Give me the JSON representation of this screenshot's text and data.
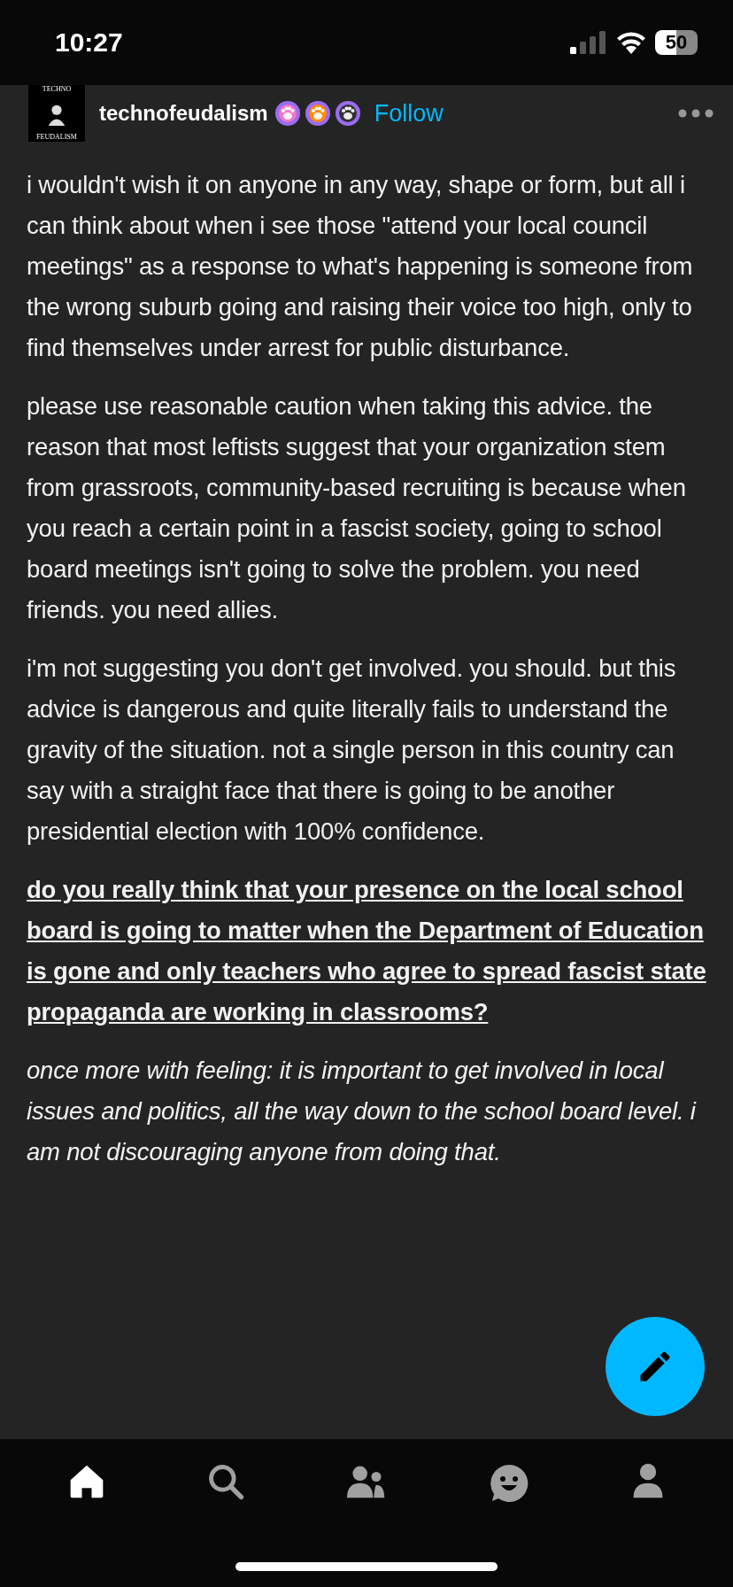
{
  "status_bar": {
    "time": "10:27",
    "battery": "50"
  },
  "post_header": {
    "avatar_top": "TECHNO",
    "avatar_bottom": "FEUDALISM",
    "username": "technofeudalism",
    "badges": [
      {
        "color": "#f277c6"
      },
      {
        "color": "#ff8a00"
      },
      {
        "color": "#333333"
      }
    ],
    "follow": "Follow"
  },
  "paragraphs": [
    {
      "kind": "plain",
      "text": "i wouldn't wish it on anyone in any way, shape or form, but all i can think about when i see those \"attend your local council meetings\" as a response to what's happening is someone from the wrong suburb going and raising their voice too high, only to find themselves under arrest for public disturbance."
    },
    {
      "kind": "plain",
      "text": "please use reasonable caution when taking this advice. the reason that most leftists suggest that your organization stem from grassroots, community-based recruiting is because when you reach a certain point in a fascist society, going to school board meetings isn't going to solve the problem. you need friends. you need allies."
    },
    {
      "kind": "plain",
      "text": "i'm not suggesting you don't get involved. you should. but this advice is dangerous and quite literally fails to understand the gravity of the situation. not a single person in this country can say with a straight face that there is going to be another presidential election with 100% confidence."
    },
    {
      "kind": "bold-underline",
      "text": "do you really think that your presence on the local school board is going to matter when the Department of Education is gone and only teachers who agree to spread fascist state propaganda are working in classrooms?"
    },
    {
      "kind": "italic",
      "text": "once more with feeling: it is important to get involved in local issues and politics, all the way down to the school board level. i am not discouraging anyone from doing that."
    }
  ],
  "tab_bar": [
    {
      "kind": "home",
      "selected": true
    },
    {
      "kind": "search",
      "selected": false
    },
    {
      "kind": "communities",
      "selected": false
    },
    {
      "kind": "activity",
      "selected": false
    },
    {
      "kind": "account",
      "selected": false
    }
  ]
}
